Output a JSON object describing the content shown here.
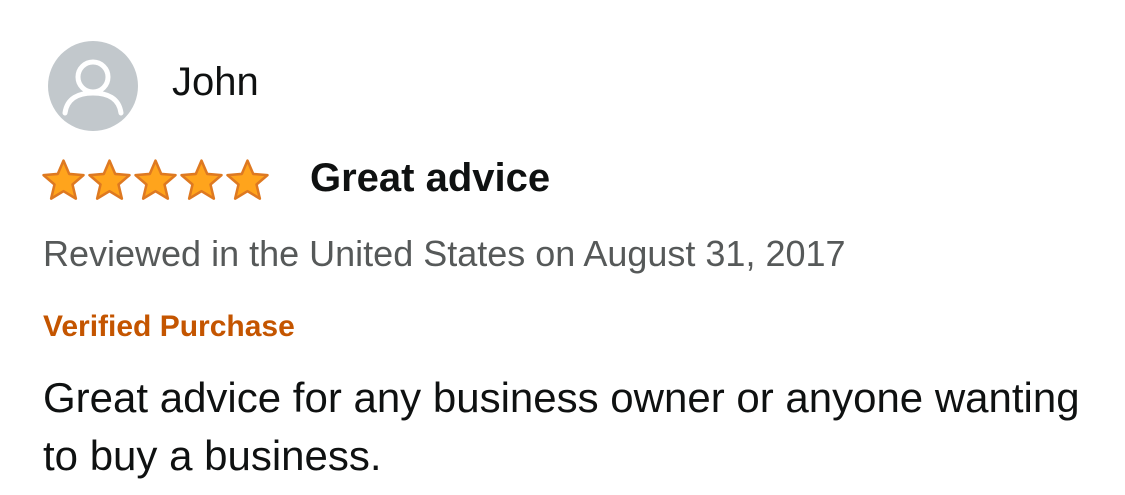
{
  "review": {
    "profile": {
      "name": "John",
      "avatar_icon": "default-user-icon"
    },
    "rating": {
      "stars": 5,
      "max_stars": 5,
      "star_icon": "star-icon",
      "star_fill_color": "#ffa41c",
      "star_stroke_color": "#de7921"
    },
    "title": "Great advice",
    "date_line": "Reviewed in the United States on August 31, 2017",
    "verified_label": "Verified Purchase",
    "body": "Great advice for any business owner or anyone wanting to buy a business.",
    "colors": {
      "verified": "#c45500",
      "meta_text": "#565959",
      "primary_text": "#0f1111",
      "avatar_bg": "#c2c8cc"
    }
  }
}
